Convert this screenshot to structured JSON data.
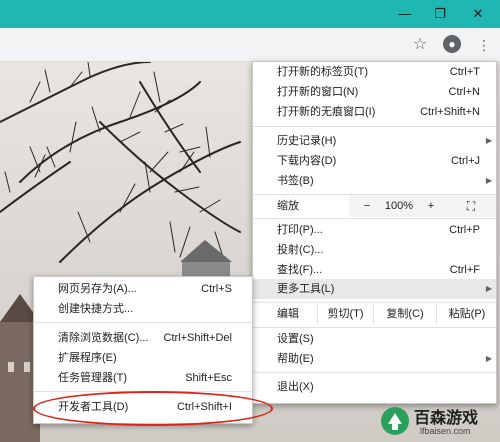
{
  "window": {
    "min_icon": "minimize-icon",
    "max_icon": "restore-icon",
    "close_icon": "close-icon",
    "titlebar_color": "#1fb7b1"
  },
  "toolbar": {
    "star_icon": "star-icon",
    "profile_icon": "profile-icon",
    "menu_icon": "more-vert-icon"
  },
  "main_menu": {
    "items": [
      {
        "label": "打开新的标签页(T)",
        "shortcut": "Ctrl+T"
      },
      {
        "label": "打开新的窗口(N)",
        "shortcut": "Ctrl+N"
      },
      {
        "label": "打开新的无痕窗口(I)",
        "shortcut": "Ctrl+Shift+N"
      },
      {
        "label": "历史记录(H)",
        "shortcut": ""
      },
      {
        "label": "下载内容(D)",
        "shortcut": "Ctrl+J"
      },
      {
        "label": "书签(B)",
        "shortcut": ""
      },
      {
        "label": "打印(P)...",
        "shortcut": "Ctrl+P"
      },
      {
        "label": "投射(C)...",
        "shortcut": ""
      },
      {
        "label": "查找(F)...",
        "shortcut": "Ctrl+F"
      },
      {
        "label": "更多工具(L)",
        "shortcut": ""
      },
      {
        "label": "设置(S)",
        "shortcut": ""
      },
      {
        "label": "帮助(E)",
        "shortcut": ""
      },
      {
        "label": "退出(X)",
        "shortcut": ""
      }
    ],
    "zoom": {
      "label": "缩放",
      "minus": "−",
      "value": "100%",
      "plus": "+"
    },
    "edit": {
      "label": "编辑",
      "cut": "剪切(T)",
      "copy": "复制(C)",
      "paste": "粘贴(P)"
    }
  },
  "submenu": {
    "items": [
      {
        "label": "网页另存为(A)...",
        "shortcut": "Ctrl+S"
      },
      {
        "label": "创建快捷方式...",
        "shortcut": ""
      },
      {
        "label": "清除浏览数据(C)...",
        "shortcut": "Ctrl+Shift+Del"
      },
      {
        "label": "扩展程序(E)",
        "shortcut": ""
      },
      {
        "label": "任务管理器(T)",
        "shortcut": "Shift+Esc"
      },
      {
        "label": "开发者工具(D)",
        "shortcut": "Ctrl+Shift+I"
      }
    ]
  },
  "watermark": {
    "title": "百森游戏",
    "url": "lfbaisen.com",
    "logo_color": "#2aa05a"
  },
  "annotation_color": "#d8261c"
}
